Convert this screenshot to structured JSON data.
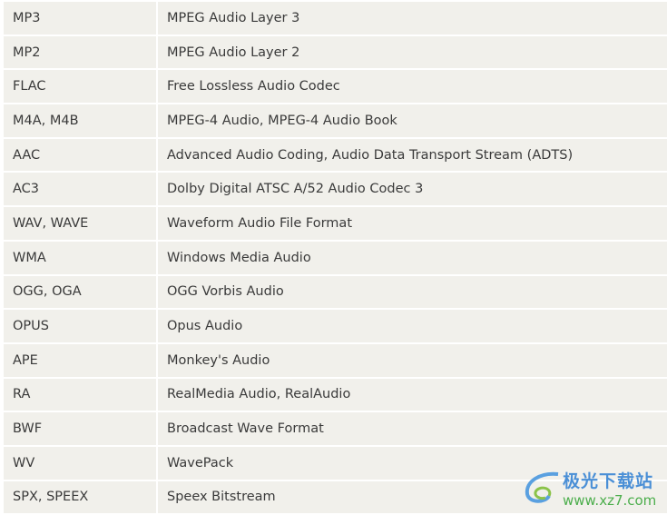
{
  "rows": [
    {
      "format": "MP3",
      "description": "MPEG Audio Layer 3"
    },
    {
      "format": "MP2",
      "description": "MPEG Audio Layer 2"
    },
    {
      "format": "FLAC",
      "description": "Free Lossless Audio Codec"
    },
    {
      "format": "M4A, M4B",
      "description": "MPEG-4 Audio, MPEG-4 Audio Book"
    },
    {
      "format": "AAC",
      "description": "Advanced Audio Coding, Audio Data Transport Stream (ADTS)"
    },
    {
      "format": "AC3",
      "description": "Dolby Digital ATSC A/52 Audio Codec 3"
    },
    {
      "format": "WAV, WAVE",
      "description": "Waveform Audio File Format"
    },
    {
      "format": "WMA",
      "description": "Windows Media Audio"
    },
    {
      "format": "OGG, OGA",
      "description": "OGG Vorbis Audio"
    },
    {
      "format": "OPUS",
      "description": "Opus Audio"
    },
    {
      "format": "APE",
      "description": "Monkey's Audio"
    },
    {
      "format": "RA",
      "description": "RealMedia Audio, RealAudio"
    },
    {
      "format": "BWF",
      "description": "Broadcast Wave Format"
    },
    {
      "format": "WV",
      "description": "WavePack"
    },
    {
      "format": "SPX, SPEEX",
      "description": "Speex Bitstream"
    }
  ],
  "watermark": {
    "name": "极光下载站",
    "url": "www.xz7.com"
  },
  "colors": {
    "cell_bg": "#f1f0eb",
    "text": "#3a3a3a"
  }
}
